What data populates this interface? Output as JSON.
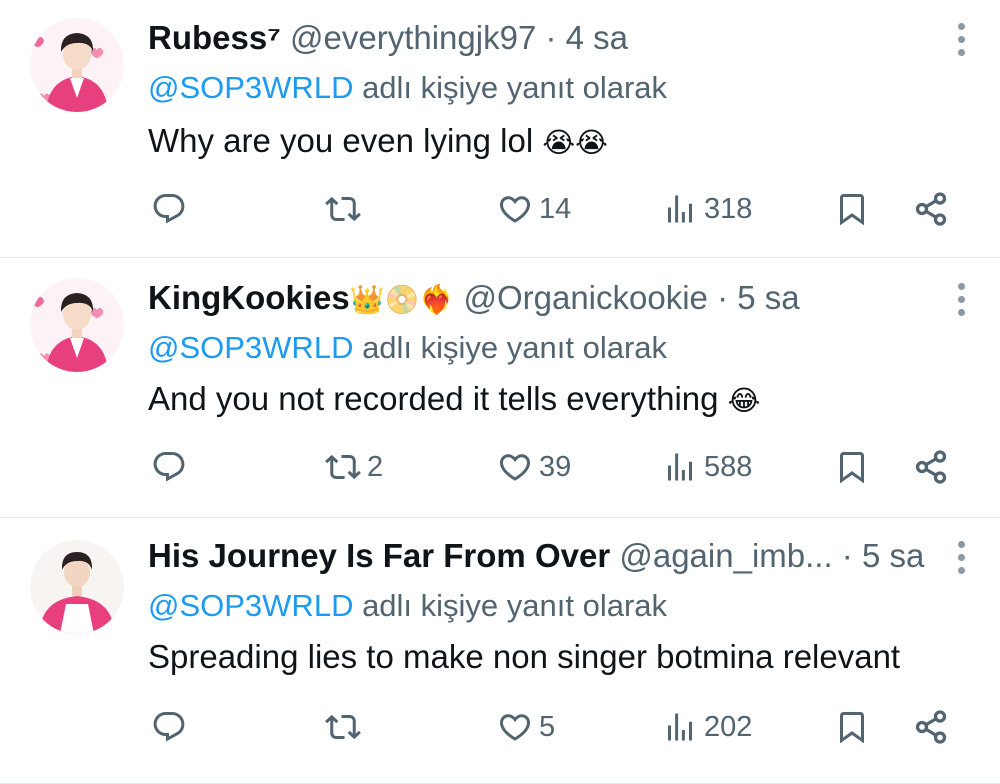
{
  "tweets": [
    {
      "name": "Rubess⁷",
      "name_emoji": "",
      "handle": "@everythingjk97",
      "separator": "·",
      "time": "4 sa",
      "reply_mention": "@SOP3WRLD",
      "reply_suffix": " adlı kişiye yanıt olarak",
      "text": "Why are you even lying lol ",
      "text_emoji": "😭😭",
      "replies": "",
      "retweets": "",
      "likes": "14",
      "views": "318"
    },
    {
      "name": "KingKookies",
      "name_emoji": "👑📀❤️‍🔥",
      "handle": "@Organickookie",
      "separator": "·",
      "time": "5 sa",
      "reply_mention": "@SOP3WRLD",
      "reply_suffix": " adlı kişiye yanıt olarak",
      "text": "And you not recorded it tells everything ",
      "text_emoji": "😂",
      "replies": "",
      "retweets": "2",
      "likes": "39",
      "views": "588"
    },
    {
      "name": "His Journey Is Far From Over",
      "name_emoji": "",
      "handle": "@again_imb...",
      "separator": "·",
      "time": "5 sa",
      "reply_mention": "@SOP3WRLD",
      "reply_suffix": " adlı kişiye yanıt olarak",
      "text": "Spreading lies to make non singer botmina relevant",
      "text_emoji": "",
      "replies": "",
      "retweets": "",
      "likes": "5",
      "views": "202"
    }
  ],
  "icons": {
    "reply": "reply-bubble-icon",
    "retweet": "retweet-icon",
    "like": "heart-icon",
    "views": "views-bar-chart-icon",
    "bookmark": "bookmark-icon",
    "share": "share-icon",
    "more": "more-vertical-icon"
  },
  "colors": {
    "text": "#0f1419",
    "secondary": "#536471",
    "mention": "#1d9bf0",
    "divider": "#e6ecf0"
  }
}
